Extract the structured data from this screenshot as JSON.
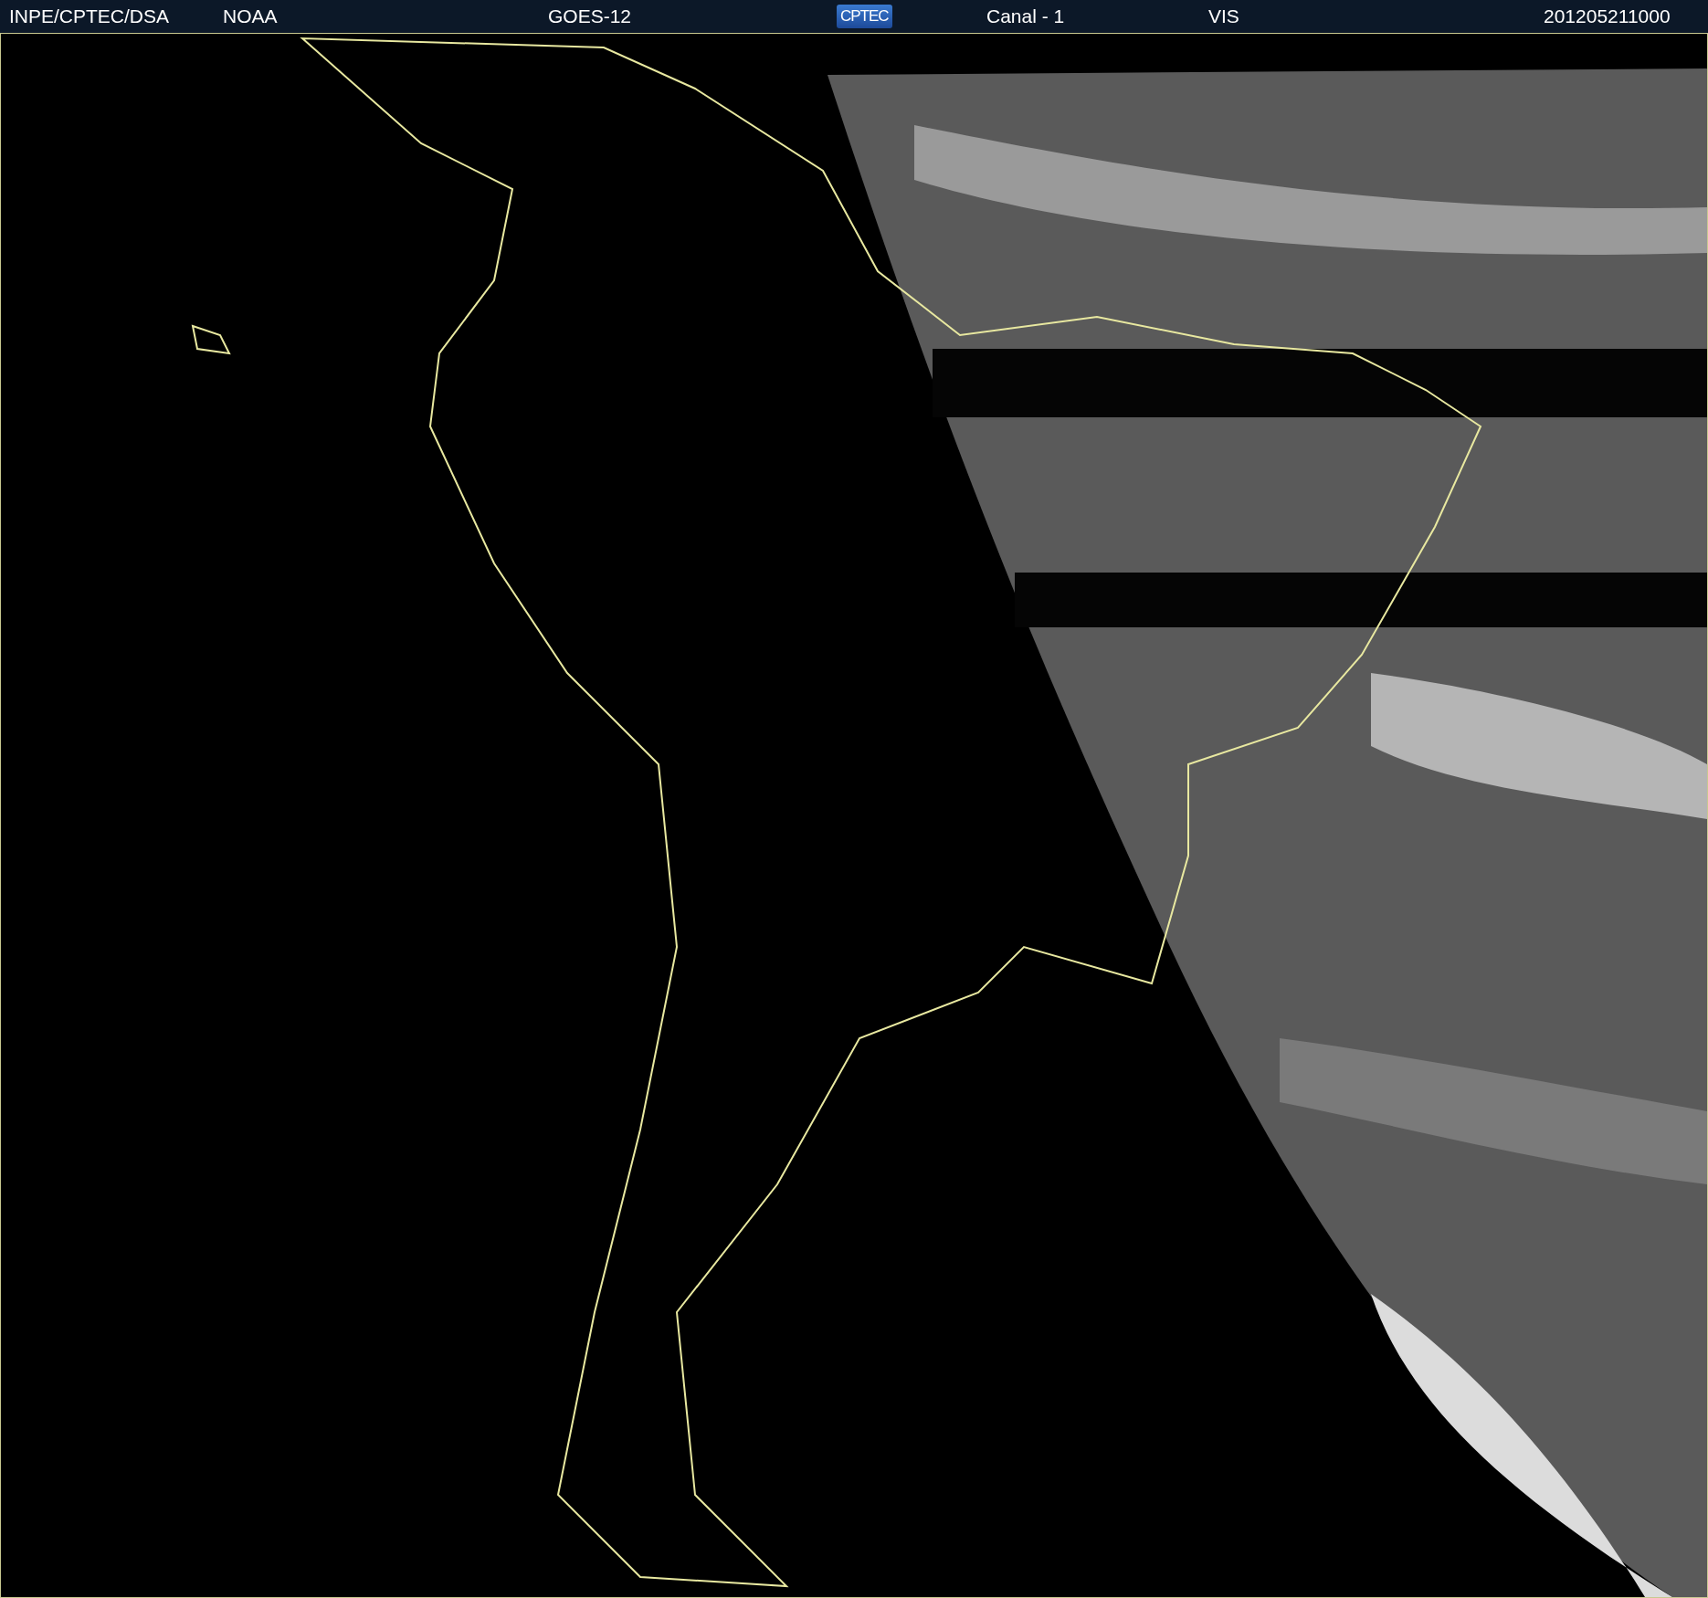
{
  "header": {
    "items": [
      {
        "kind": "text",
        "text": "INPE/CPTEC/DSA"
      },
      {
        "kind": "text",
        "text": "NOAA"
      },
      {
        "kind": "text",
        "text": "GOES-12"
      },
      {
        "kind": "logo",
        "text": "CPTEC"
      },
      {
        "kind": "text",
        "text": "Canal - 1"
      },
      {
        "kind": "text",
        "text": "VIS"
      },
      {
        "kind": "text",
        "text": "201205211000"
      }
    ]
  }
}
